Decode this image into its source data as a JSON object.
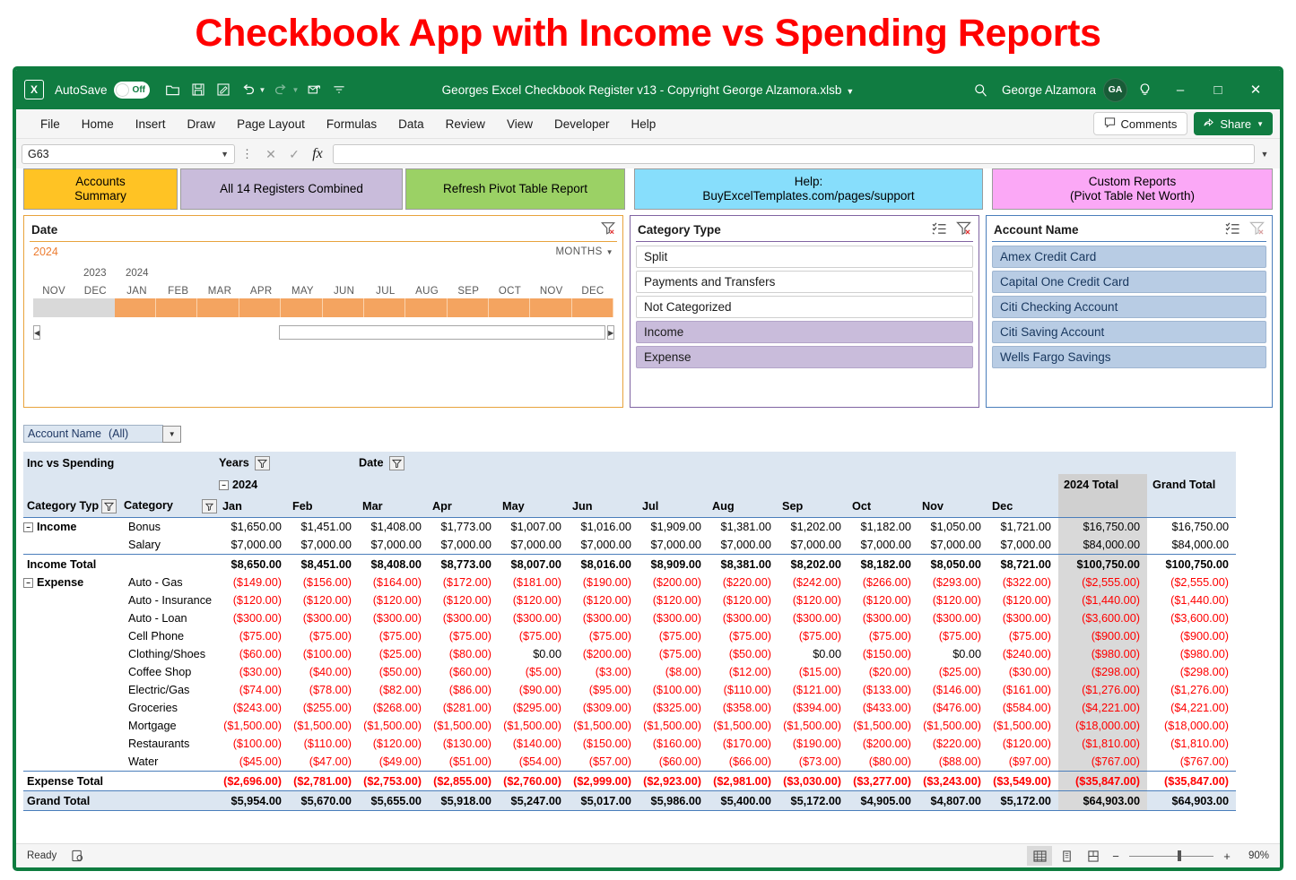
{
  "banner": {
    "title": "Checkbook App with Income vs Spending Reports"
  },
  "titlebar": {
    "app_icon": "excel-icon",
    "autosave_label": "AutoSave",
    "autosave_state": "Off",
    "doc_title": "Georges Excel Checkbook Register v13 - Copyright George Alzamora.xlsb",
    "user_name": "George Alzamora",
    "user_initials": "GA",
    "quick_access": [
      "open-icon",
      "save-icon",
      "save-as-icon",
      "undo-icon",
      "redo-icon",
      "email-icon",
      "customize-qat-icon"
    ],
    "search_icon": "search-icon",
    "help_icon": "lightbulb-icon",
    "minimize": "–",
    "maximize": "□",
    "close": "✕"
  },
  "ribbon": {
    "tabs": [
      "File",
      "Home",
      "Insert",
      "Draw",
      "Page Layout",
      "Formulas",
      "Data",
      "Review",
      "View",
      "Developer",
      "Help"
    ],
    "comments_label": "Comments",
    "share_label": "Share"
  },
  "formula_bar": {
    "name_box": "G63",
    "cancel_icon": "close-icon",
    "enter_icon": "check-icon",
    "function_icon": "fx-icon",
    "formula_value": "",
    "formula_placeholder": ""
  },
  "nav_buttons": [
    {
      "line1": "Accounts",
      "line2": "Summary",
      "color": "#FFC324"
    },
    {
      "line1": "All 14 Registers Combined",
      "line2": "",
      "color": "#C9BCDB"
    },
    {
      "line1": "Refresh Pivot Table Report",
      "line2": "",
      "color": "#9BD165"
    },
    {
      "line1": "Help:",
      "line2": "BuyExcelTemplates.com/pages/support",
      "color": "#87DEFC"
    },
    {
      "line1": "Custom Reports",
      "line2": "(Pivot Table Net Worth)",
      "color": "#FBA8F6"
    }
  ],
  "timeline_slicer": {
    "title": "Date",
    "clear_filter_icon": "clear-filter-icon",
    "selected_year": "2024",
    "level_label": "MONTHS",
    "year_labels": [
      "2023",
      "2024"
    ],
    "months": [
      "NOV",
      "DEC",
      "JAN",
      "FEB",
      "MAR",
      "APR",
      "MAY",
      "JUN",
      "JUL",
      "AUG",
      "SEP",
      "OCT",
      "NOV",
      "DEC"
    ],
    "selected_months": [
      "JAN",
      "FEB",
      "MAR",
      "APR",
      "MAY",
      "JUN",
      "JUL",
      "AUG",
      "SEP",
      "OCT",
      "NOV",
      "DEC"
    ],
    "scroll_left_icon": "arrow-left-icon",
    "scroll_right_icon": "arrow-right-icon",
    "accent": "#ED7D31"
  },
  "category_slicer": {
    "title": "Category Type",
    "multiselect_icon": "multi-select-icon",
    "clear_filter_icon": "clear-filter-icon",
    "items": [
      {
        "label": "Split",
        "selected": false
      },
      {
        "label": "Payments and Transfers",
        "selected": false
      },
      {
        "label": "Not Categorized",
        "selected": false
      },
      {
        "label": "Income",
        "selected": true
      },
      {
        "label": "Expense",
        "selected": true
      }
    ],
    "accent": "#8064A2"
  },
  "account_slicer": {
    "title": "Account Name",
    "multiselect_icon": "multi-select-icon",
    "clear_filter_icon": "clear-filter-icon",
    "items": [
      {
        "label": "Amex Credit Card",
        "selected": true
      },
      {
        "label": "Capital One Credit Card",
        "selected": true
      },
      {
        "label": "Citi Checking Account",
        "selected": true
      },
      {
        "label": "Citi Saving Account",
        "selected": true
      },
      {
        "label": "Wells Fargo Savings",
        "selected": true
      }
    ],
    "accent": "#4A7EBB"
  },
  "page_filter": {
    "field": "Account Name",
    "value": "(All)",
    "dropdown_icon": "chevron-down-icon"
  },
  "pivot": {
    "title": "Inc vs Spending",
    "years_label": "Years",
    "date_label": "Date",
    "year_group": "2024",
    "category_type_header": "Category Typ",
    "category_header": "Category",
    "filter_icon": "filter-icon",
    "sort_filter_icon": "sort-filter-icon",
    "total_col_label": "2024 Total",
    "grand_total_col_label": "Grand Total",
    "income_group": "Income",
    "expense_group": "Expense",
    "income_total_label": "Income Total",
    "expense_total_label": "Expense Total",
    "grand_total_label": "Grand Total"
  },
  "chart_data": {
    "type": "table",
    "title": "Inc vs Spending",
    "months": [
      "Jan",
      "Feb",
      "Mar",
      "Apr",
      "May",
      "Jun",
      "Jul",
      "Aug",
      "Sep",
      "Oct",
      "Nov",
      "Dec"
    ],
    "income_rows": [
      {
        "category": "Bonus",
        "values": [
          "$1,650.00",
          "$1,451.00",
          "$1,408.00",
          "$1,773.00",
          "$1,007.00",
          "$1,016.00",
          "$1,909.00",
          "$1,381.00",
          "$1,202.00",
          "$1,182.00",
          "$1,050.00",
          "$1,721.00"
        ],
        "total": "$16,750.00",
        "grand": "$16,750.00"
      },
      {
        "category": "Salary",
        "values": [
          "$7,000.00",
          "$7,000.00",
          "$7,000.00",
          "$7,000.00",
          "$7,000.00",
          "$7,000.00",
          "$7,000.00",
          "$7,000.00",
          "$7,000.00",
          "$7,000.00",
          "$7,000.00",
          "$7,000.00"
        ],
        "total": "$84,000.00",
        "grand": "$84,000.00"
      }
    ],
    "income_total": {
      "values": [
        "$8,650.00",
        "$8,451.00",
        "$8,408.00",
        "$8,773.00",
        "$8,007.00",
        "$8,016.00",
        "$8,909.00",
        "$8,381.00",
        "$8,202.00",
        "$8,182.00",
        "$8,050.00",
        "$8,721.00"
      ],
      "total": "$100,750.00",
      "grand": "$100,750.00"
    },
    "expense_rows": [
      {
        "category": "Auto - Gas",
        "values": [
          "($149.00)",
          "($156.00)",
          "($164.00)",
          "($172.00)",
          "($181.00)",
          "($190.00)",
          "($200.00)",
          "($220.00)",
          "($242.00)",
          "($266.00)",
          "($293.00)",
          "($322.00)"
        ],
        "total": "($2,555.00)",
        "grand": "($2,555.00)"
      },
      {
        "category": "Auto - Insurance",
        "values": [
          "($120.00)",
          "($120.00)",
          "($120.00)",
          "($120.00)",
          "($120.00)",
          "($120.00)",
          "($120.00)",
          "($120.00)",
          "($120.00)",
          "($120.00)",
          "($120.00)",
          "($120.00)"
        ],
        "total": "($1,440.00)",
        "grand": "($1,440.00)"
      },
      {
        "category": "Auto - Loan",
        "values": [
          "($300.00)",
          "($300.00)",
          "($300.00)",
          "($300.00)",
          "($300.00)",
          "($300.00)",
          "($300.00)",
          "($300.00)",
          "($300.00)",
          "($300.00)",
          "($300.00)",
          "($300.00)"
        ],
        "total": "($3,600.00)",
        "grand": "($3,600.00)"
      },
      {
        "category": "Cell Phone",
        "values": [
          "($75.00)",
          "($75.00)",
          "($75.00)",
          "($75.00)",
          "($75.00)",
          "($75.00)",
          "($75.00)",
          "($75.00)",
          "($75.00)",
          "($75.00)",
          "($75.00)",
          "($75.00)"
        ],
        "total": "($900.00)",
        "grand": "($900.00)"
      },
      {
        "category": "Clothing/Shoes",
        "values": [
          "($60.00)",
          "($100.00)",
          "($25.00)",
          "($80.00)",
          "$0.00",
          "($200.00)",
          "($75.00)",
          "($50.00)",
          "$0.00",
          "($150.00)",
          "$0.00",
          "($240.00)"
        ],
        "total": "($980.00)",
        "grand": "($980.00)"
      },
      {
        "category": "Coffee Shop",
        "values": [
          "($30.00)",
          "($40.00)",
          "($50.00)",
          "($60.00)",
          "($5.00)",
          "($3.00)",
          "($8.00)",
          "($12.00)",
          "($15.00)",
          "($20.00)",
          "($25.00)",
          "($30.00)"
        ],
        "total": "($298.00)",
        "grand": "($298.00)"
      },
      {
        "category": "Electric/Gas",
        "values": [
          "($74.00)",
          "($78.00)",
          "($82.00)",
          "($86.00)",
          "($90.00)",
          "($95.00)",
          "($100.00)",
          "($110.00)",
          "($121.00)",
          "($133.00)",
          "($146.00)",
          "($161.00)"
        ],
        "total": "($1,276.00)",
        "grand": "($1,276.00)"
      },
      {
        "category": "Groceries",
        "values": [
          "($243.00)",
          "($255.00)",
          "($268.00)",
          "($281.00)",
          "($295.00)",
          "($309.00)",
          "($325.00)",
          "($358.00)",
          "($394.00)",
          "($433.00)",
          "($476.00)",
          "($584.00)"
        ],
        "total": "($4,221.00)",
        "grand": "($4,221.00)"
      },
      {
        "category": "Mortgage",
        "values": [
          "($1,500.00)",
          "($1,500.00)",
          "($1,500.00)",
          "($1,500.00)",
          "($1,500.00)",
          "($1,500.00)",
          "($1,500.00)",
          "($1,500.00)",
          "($1,500.00)",
          "($1,500.00)",
          "($1,500.00)",
          "($1,500.00)"
        ],
        "total": "($18,000.00)",
        "grand": "($18,000.00)"
      },
      {
        "category": "Restaurants",
        "values": [
          "($100.00)",
          "($110.00)",
          "($120.00)",
          "($130.00)",
          "($140.00)",
          "($150.00)",
          "($160.00)",
          "($170.00)",
          "($190.00)",
          "($200.00)",
          "($220.00)",
          "($120.00)"
        ],
        "total": "($1,810.00)",
        "grand": "($1,810.00)"
      },
      {
        "category": "Water",
        "values": [
          "($45.00)",
          "($47.00)",
          "($49.00)",
          "($51.00)",
          "($54.00)",
          "($57.00)",
          "($60.00)",
          "($66.00)",
          "($73.00)",
          "($80.00)",
          "($88.00)",
          "($97.00)"
        ],
        "total": "($767.00)",
        "grand": "($767.00)"
      }
    ],
    "expense_total": {
      "values": [
        "($2,696.00)",
        "($2,781.00)",
        "($2,753.00)",
        "($2,855.00)",
        "($2,760.00)",
        "($2,999.00)",
        "($2,923.00)",
        "($2,981.00)",
        "($3,030.00)",
        "($3,277.00)",
        "($3,243.00)",
        "($3,549.00)"
      ],
      "total": "($35,847.00)",
      "grand": "($35,847.00)"
    },
    "grand_total": {
      "values": [
        "$5,954.00",
        "$5,670.00",
        "$5,655.00",
        "$5,918.00",
        "$5,247.00",
        "$5,017.00",
        "$5,986.00",
        "$5,400.00",
        "$5,172.00",
        "$4,905.00",
        "$4,807.00",
        "$5,172.00"
      ],
      "total": "$64,903.00",
      "grand": "$64,903.00"
    }
  },
  "status_bar": {
    "status": "Ready",
    "macro_icon": "macro-record-icon",
    "views": [
      "normal-view-icon",
      "page-layout-view-icon",
      "page-break-view-icon"
    ],
    "active_view": 0,
    "zoom_out": "−",
    "zoom_in": "+",
    "zoom_level": "90%"
  }
}
